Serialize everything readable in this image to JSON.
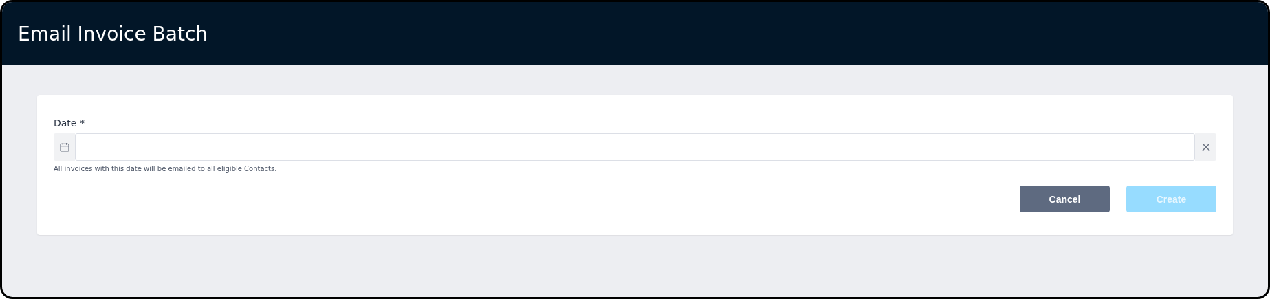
{
  "window": {
    "title": "Email Invoice Batch"
  },
  "form": {
    "field": {
      "label": "Date",
      "required_mark": "*",
      "hint": "All invoices with this date will be emailed to all eligible Contacts."
    },
    "buttons": [
      {
        "label": "Cancel",
        "kind": "secondary",
        "disabled": false
      },
      {
        "label": "Create",
        "kind": "primary",
        "disabled": true
      }
    ]
  }
}
